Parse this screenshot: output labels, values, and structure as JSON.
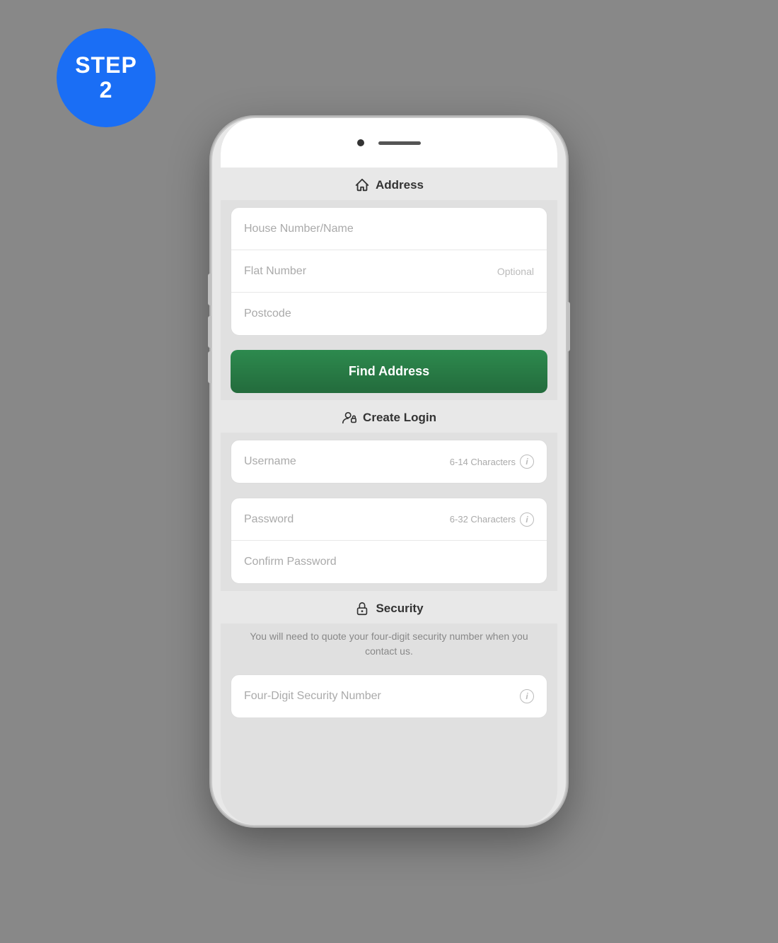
{
  "step_badge": {
    "line1": "STEP",
    "line2": "2"
  },
  "address_section": {
    "header": "Address",
    "fields": [
      {
        "id": "house-number",
        "placeholder": "House Number/Name",
        "hint": "",
        "optional": false
      },
      {
        "id": "flat-number",
        "placeholder": "Flat Number",
        "hint": "",
        "optional": true
      },
      {
        "id": "postcode",
        "placeholder": "Postcode",
        "hint": "",
        "optional": false
      }
    ],
    "find_address_button": "Find Address"
  },
  "login_section": {
    "header": "Create Login",
    "username_placeholder": "Username",
    "username_hint": "6-14 Characters",
    "password_placeholder": "Password",
    "password_hint": "6-32 Characters",
    "confirm_password_placeholder": "Confirm Password"
  },
  "security_section": {
    "header": "Security",
    "description": "You will need to quote your four-digit security number when you contact us.",
    "field_placeholder": "Four-Digit Security Number"
  },
  "colors": {
    "green": "#2d8a4e",
    "blue": "#1a6ef5"
  }
}
